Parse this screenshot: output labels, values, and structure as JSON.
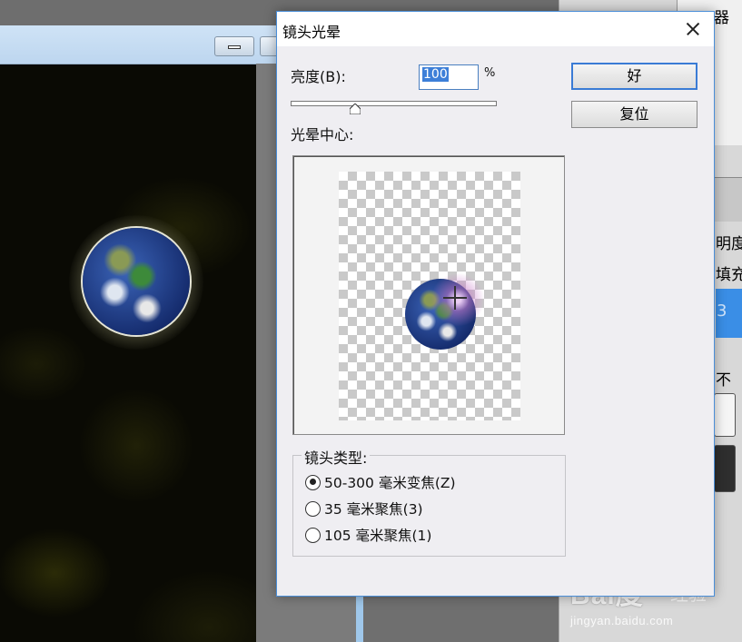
{
  "right_panel": {
    "labels": [
      "器",
      "明度",
      "填充",
      "3",
      "不"
    ]
  },
  "dialog": {
    "title": "镜头光晕",
    "brightness_label": "亮度(B):",
    "brightness_value": "100",
    "percent_sign": "%",
    "ok_label": "好",
    "reset_label": "复位",
    "flare_center_label": "光晕中心:",
    "lens_type_label": "镜头类型:",
    "lens_options": [
      {
        "label": "50-300 毫米变焦(Z)",
        "checked": true
      },
      {
        "label": "35 毫米聚焦(3)",
        "checked": false
      },
      {
        "label": "105 毫米聚焦(1)",
        "checked": false
      }
    ],
    "slider_value_fraction": 0.33
  },
  "watermark": {
    "logo": "Bai度",
    "text": "经验",
    "url": "jingyan.baidu.com"
  },
  "colors": {
    "accent": "#3a7bd5",
    "dialog_bg": "#efeef2",
    "selected_text_bg": "#3d7fd8"
  },
  "icons": [
    "close-icon",
    "minimize-icon",
    "crosshair-icon"
  ]
}
